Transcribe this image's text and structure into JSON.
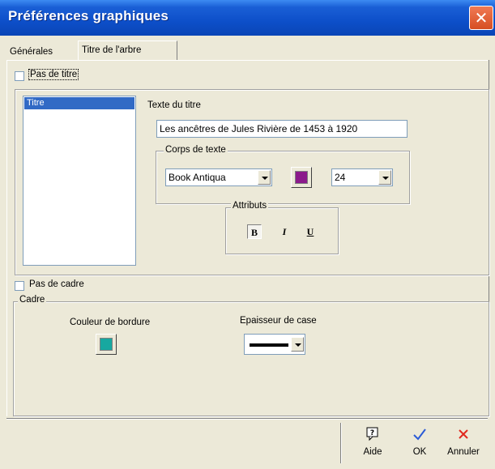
{
  "window": {
    "title": "Préférences graphiques"
  },
  "tabs": [
    {
      "label": "Générales",
      "active": false
    },
    {
      "label": "Titre de l'arbre",
      "active": true
    }
  ],
  "no_title": {
    "label": "Pas de titre",
    "checked": false
  },
  "title_list": {
    "items": [
      "Titre"
    ],
    "selected": "Titre"
  },
  "title_text": {
    "label": "Texte du titre",
    "value": "Les ancêtres de Jules Rivière de 1453 à 1920"
  },
  "font_body": {
    "label": "Corps de texte",
    "font": "Book Antiqua",
    "color": "#8b1a8b",
    "size": "24"
  },
  "attributes": {
    "label": "Attributs",
    "bold": "B",
    "italic": "I",
    "underline": "U"
  },
  "no_frame": {
    "label": "Pas de cadre",
    "checked": false
  },
  "frame": {
    "label": "Cadre",
    "border_color_label": "Couleur de bordure",
    "border_color": "#17a8a0",
    "box_thickness_label": "Epaisseur de case"
  },
  "buttons": {
    "help": {
      "label": "Aide",
      "icon": "help-icon"
    },
    "ok": {
      "label": "OK",
      "icon": "check-icon"
    },
    "cancel": {
      "label": "Annuler",
      "icon": "cross-icon"
    }
  }
}
